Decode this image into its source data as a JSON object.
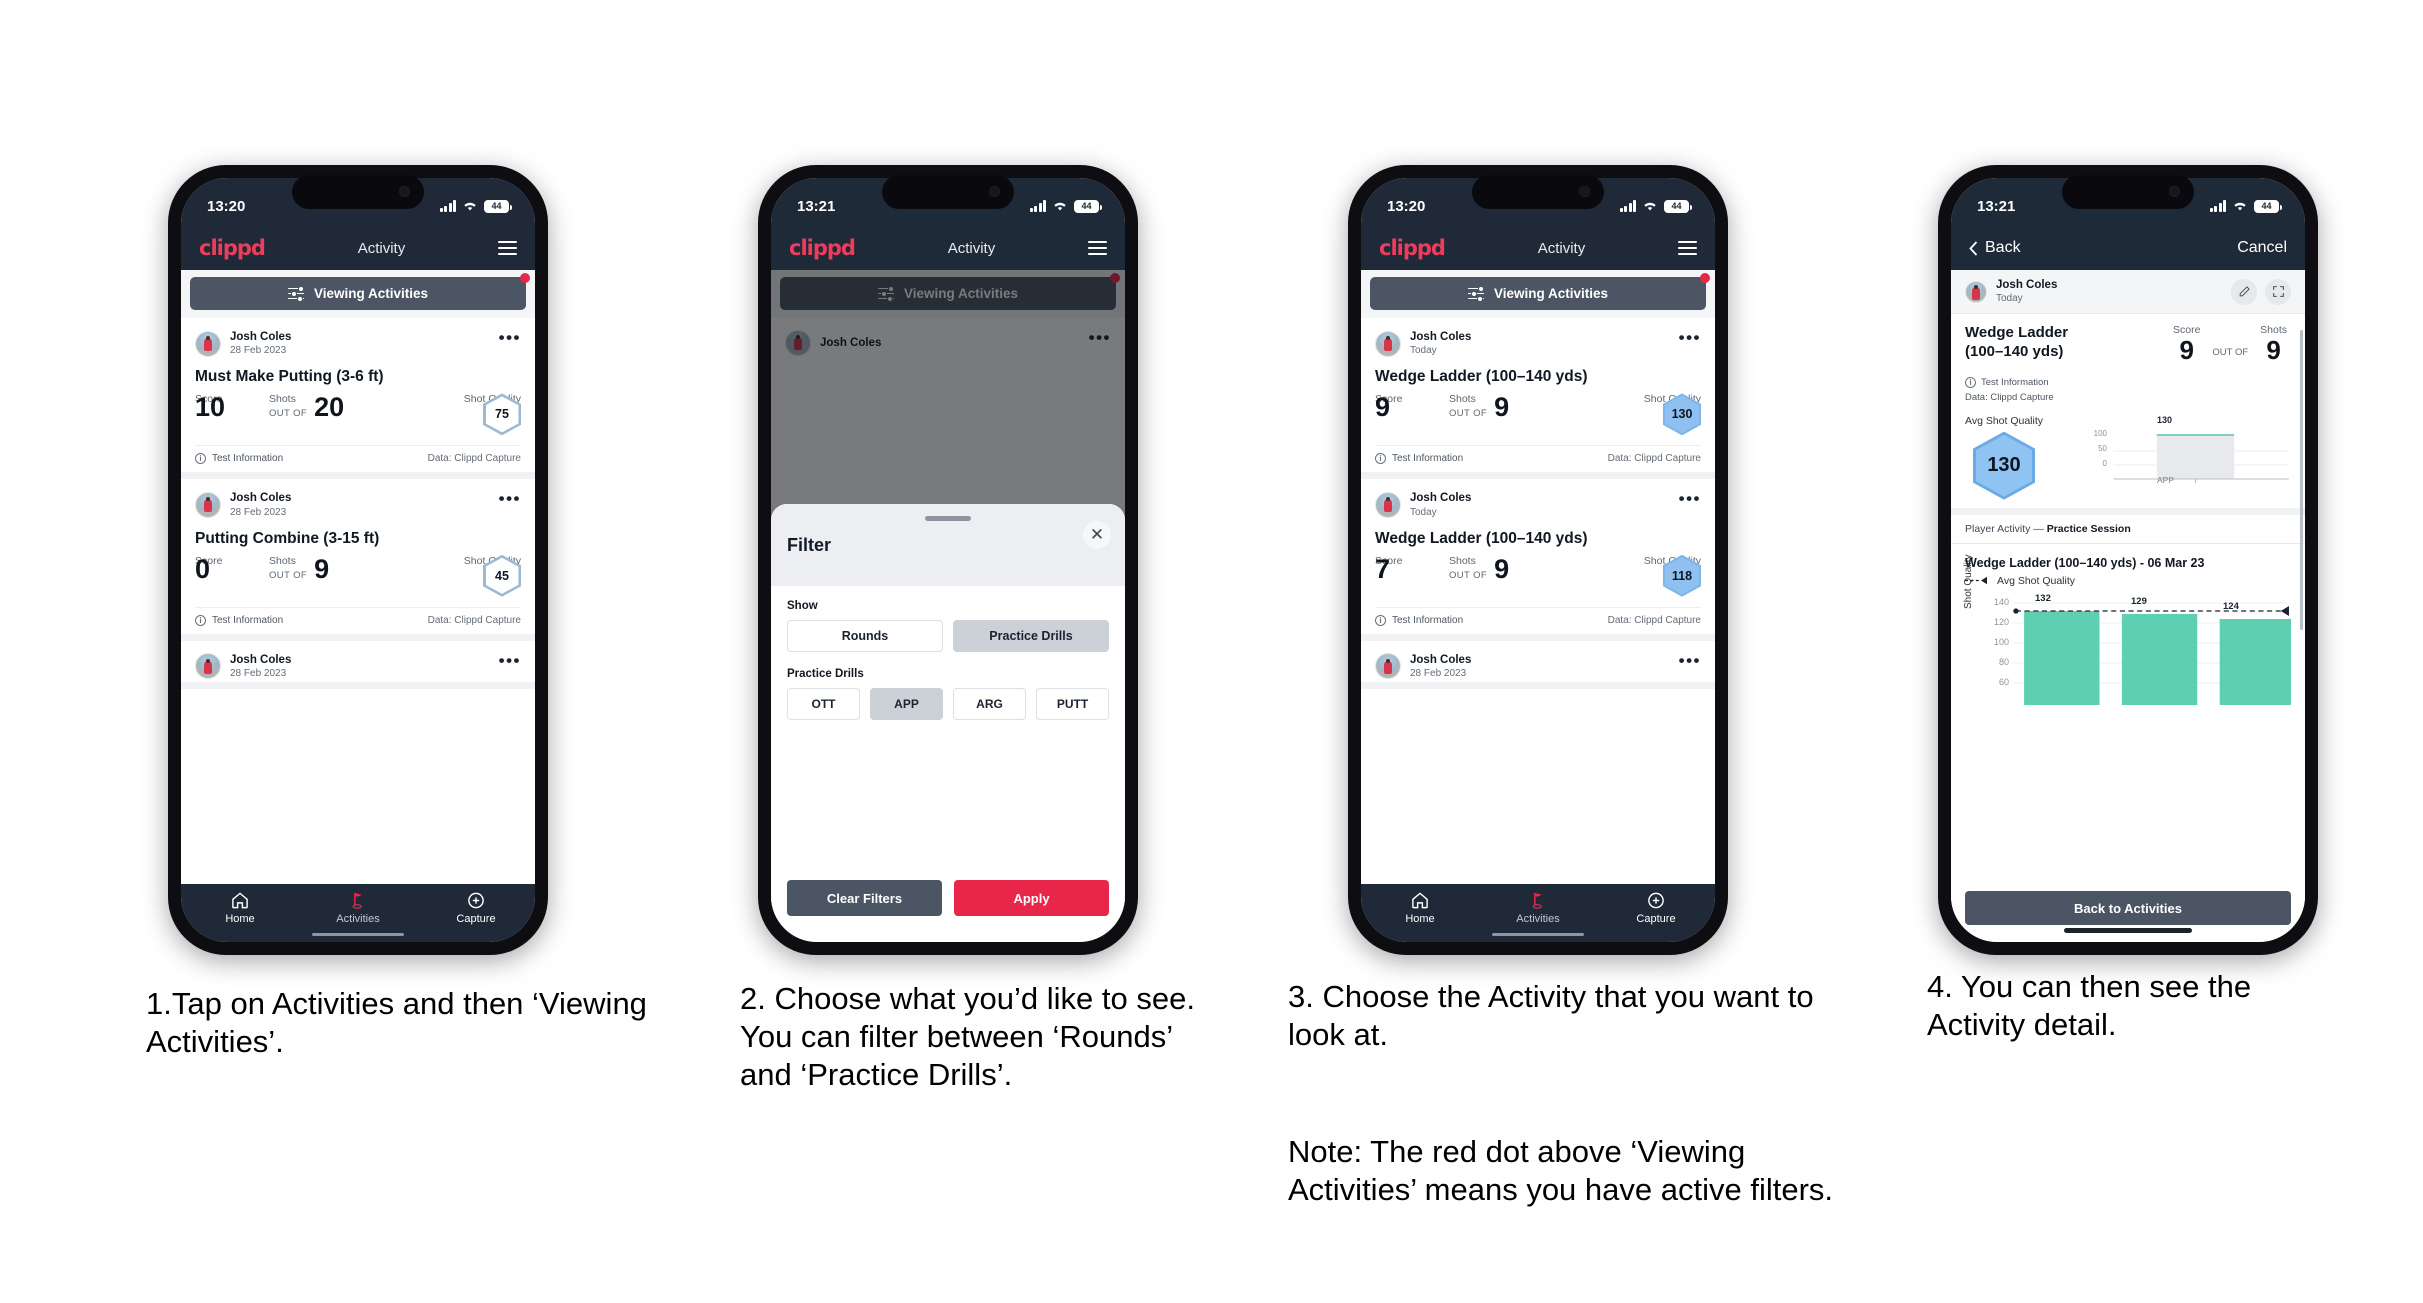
{
  "phones": [
    {
      "status": {
        "time": "13:20",
        "battery": "44"
      },
      "appbar": {
        "logo": "clippd",
        "title": "Activity"
      },
      "filterbar": {
        "label": "Viewing Activities",
        "has_red_dot": true
      },
      "cards": [
        {
          "user": "Josh Coles",
          "date": "28 Feb 2023",
          "title": "Must Make Putting (3-6 ft)",
          "score_label": "Score",
          "shots_label": "Shots",
          "quality_label": "Shot Quality",
          "score": "10",
          "outof": "OUT OF",
          "shots": "20",
          "quality": "75",
          "quality_style": "outline",
          "foot_left": "Test Information",
          "foot_right": "Data: Clippd Capture"
        },
        {
          "user": "Josh Coles",
          "date": "28 Feb 2023",
          "title": "Putting Combine (3-15 ft)",
          "score_label": "Score",
          "shots_label": "Shots",
          "quality_label": "Shot Quality",
          "score": "0",
          "outof": "OUT OF",
          "shots": "9",
          "quality": "45",
          "quality_style": "outline",
          "foot_left": "Test Information",
          "foot_right": "Data: Clippd Capture"
        },
        {
          "user": "Josh Coles",
          "date": "28 Feb 2023",
          "partial": true
        }
      ],
      "tabs": [
        {
          "label": "Home",
          "icon": "home-icon",
          "active": false
        },
        {
          "label": "Activities",
          "icon": "golf-flag-icon",
          "active": true
        },
        {
          "label": "Capture",
          "icon": "plus-circle-icon",
          "active": false
        }
      ]
    },
    {
      "status": {
        "time": "13:21",
        "battery": "44"
      },
      "appbar": {
        "logo": "clippd",
        "title": "Activity"
      },
      "filterbar": {
        "label": "Viewing Activities",
        "has_red_dot": true
      },
      "behind_card": {
        "user": "Josh Coles"
      },
      "modal": {
        "title": "Filter",
        "close_label": "✕",
        "show_label": "Show",
        "show_options": [
          {
            "label": "Rounds",
            "selected": false
          },
          {
            "label": "Practice Drills",
            "selected": true
          }
        ],
        "drills_label": "Practice Drills",
        "drill_options": [
          {
            "label": "OTT",
            "selected": false
          },
          {
            "label": "APP",
            "selected": true
          },
          {
            "label": "ARG",
            "selected": false
          },
          {
            "label": "PUTT",
            "selected": false
          }
        ],
        "clear_label": "Clear Filters",
        "apply_label": "Apply",
        "apply_color": "#e8264a"
      }
    },
    {
      "status": {
        "time": "13:20",
        "battery": "44"
      },
      "appbar": {
        "logo": "clippd",
        "title": "Activity"
      },
      "filterbar": {
        "label": "Viewing Activities",
        "has_red_dot": true
      },
      "cards": [
        {
          "user": "Josh Coles",
          "date": "Today",
          "title": "Wedge Ladder (100–140 yds)",
          "score_label": "Score",
          "shots_label": "Shots",
          "quality_label": "Shot Quality",
          "score": "9",
          "outof": "OUT OF",
          "shots": "9",
          "quality": "130",
          "quality_style": "filled",
          "foot_left": "Test Information",
          "foot_right": "Data: Clippd Capture"
        },
        {
          "user": "Josh Coles",
          "date": "Today",
          "title": "Wedge Ladder (100–140 yds)",
          "score_label": "Score",
          "shots_label": "Shots",
          "quality_label": "Shot Quality",
          "score": "7",
          "outof": "OUT OF",
          "shots": "9",
          "quality": "118",
          "quality_style": "filled",
          "foot_left": "Test Information",
          "foot_right": "Data: Clippd Capture"
        },
        {
          "user": "Josh Coles",
          "date": "28 Feb 2023",
          "partial": true
        }
      ],
      "tabs": [
        {
          "label": "Home",
          "icon": "home-icon",
          "active": false
        },
        {
          "label": "Activities",
          "icon": "golf-flag-icon",
          "active": true
        },
        {
          "label": "Capture",
          "icon": "plus-circle-icon",
          "active": false
        }
      ]
    },
    {
      "status": {
        "time": "13:21",
        "battery": "44"
      },
      "appbar": {
        "back_label": "Back",
        "cancel_label": "Cancel"
      },
      "detail": {
        "user": "Josh Coles",
        "date": "Today",
        "edit_icon": "pencil-icon",
        "expand_icon": "fullscreen-icon",
        "title": "Wedge Ladder\n(100–140 yds)",
        "score_label": "Score",
        "shots_label": "Shots",
        "score": "9",
        "outof": "OUT OF",
        "shots": "9",
        "meta_info": "Test Information",
        "meta_data": "Data: Clippd Capture",
        "avg_label": "Avg Shot Quality",
        "avg_value": "130",
        "section_head_prefix": "Player Activity — ",
        "section_head_bold": "Practice Session",
        "chart_title": "Wedge Ladder (100–140 yds) - 06 Mar 23",
        "legend": "Avg Shot Quality",
        "back_button": "Back to Activities"
      }
    }
  ],
  "chart_data": [
    {
      "type": "bar",
      "title": "Avg Shot Quality",
      "categories": [
        "APP"
      ],
      "values": [
        130
      ],
      "data_labels": [
        "130"
      ],
      "ylabel": "",
      "ytick_labels": [
        "100",
        "50",
        "0"
      ],
      "ylim": [
        0,
        150
      ],
      "bar_color": "#e6e8eb",
      "cap_color": "#7dd3b8",
      "grid": true,
      "legend": false
    },
    {
      "type": "bar",
      "title": "Wedge Ladder (100–140 yds) - 06 Mar 23",
      "categories": [
        "",
        "",
        ""
      ],
      "values": [
        132,
        129,
        124
      ],
      "data_labels": [
        "132",
        "129",
        "124"
      ],
      "ylabel": "Shot Quality",
      "ytick_labels": [
        "140",
        "120",
        "100",
        "80",
        "60"
      ],
      "ylim": [
        50,
        145
      ],
      "bar_color": "#5ecfb0",
      "grid": true,
      "legend": true,
      "legend_entries": [
        "Avg Shot Quality"
      ],
      "annotation_line": {
        "style": "dashed",
        "label": "Avg Shot Quality"
      }
    }
  ],
  "captions": [
    "1.Tap on Activities and then ‘Viewing Activities’.",
    "2. Choose what you’d like to see. You can filter between ‘Rounds’ and ‘Practice Drills’.",
    "3. Choose the Activity that you want to look at.",
    "Note: The red dot above ‘Viewing Activities’ means you have active filters.",
    "4. You can then see the Activity detail."
  ]
}
